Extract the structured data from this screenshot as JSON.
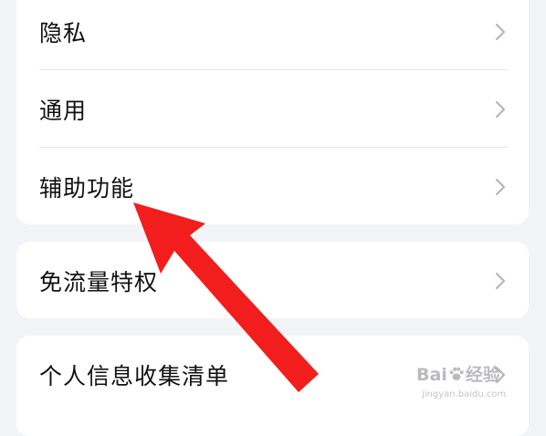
{
  "settings": {
    "group1": [
      {
        "label": "隐私"
      },
      {
        "label": "通用"
      },
      {
        "label": "辅助功能"
      }
    ],
    "group2": [
      {
        "label": "免流量特权"
      }
    ],
    "group3": [
      {
        "label": "个人信息收集清单"
      }
    ]
  },
  "icons": {
    "chevron": "chevron-right-icon",
    "arrow": "red-pointer-arrow",
    "watermark_paw": "baidu-paw-icon"
  },
  "colors": {
    "background": "#f3f4f7",
    "card": "#ffffff",
    "text": "#111111",
    "chevron": "#b3b3b8",
    "arrow": "#f21d1d"
  },
  "watermark": {
    "brand_left": "Bai",
    "brand_right": "经验",
    "url": "jingyan.baidu.com"
  }
}
